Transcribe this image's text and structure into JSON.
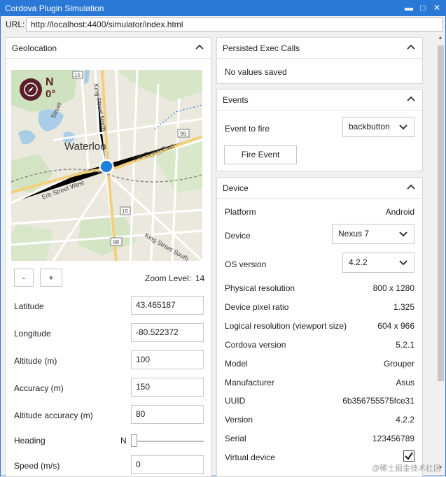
{
  "window": {
    "title": "Cordova Plugin Simulation"
  },
  "url_bar": {
    "label": "URL:",
    "value": "http://localhost:4400/simulator/index.html"
  },
  "geolocation": {
    "title": "Geolocation",
    "map": {
      "compass_heading": "N",
      "compass_degrees": "0°",
      "city_label": "Waterloo",
      "street_labels": [
        "Erb Street East",
        "Erb Street West",
        "King Street South",
        "King Street North",
        "Street"
      ],
      "route_numbers": [
        "98",
        "15",
        "98",
        "15"
      ]
    },
    "zoom_out_label": "-",
    "zoom_in_label": "+",
    "zoom_label": "Zoom Level:",
    "zoom_value": "14",
    "fields": [
      {
        "label": "Latitude",
        "value": "43.465187"
      },
      {
        "label": "Longitude",
        "value": "-80.522372"
      },
      {
        "label": "Altitude (m)",
        "value": "100"
      },
      {
        "label": "Accuracy (m)",
        "value": "150"
      },
      {
        "label": "Altitude accuracy (m)",
        "value": "80"
      }
    ],
    "heading_label": "Heading",
    "heading_value": "N",
    "heading_level": 0,
    "speed_label": "Speed (m/s)",
    "speed_value": "0"
  },
  "persisted": {
    "title": "Persisted Exec Calls",
    "empty_text": "No values saved"
  },
  "events": {
    "title": "Events",
    "event_label": "Event to fire",
    "event_selected": "backbutton",
    "fire_button": "Fire Event"
  },
  "device": {
    "title": "Device",
    "platform_label": "Platform",
    "platform_value": "Android",
    "device_label": "Device",
    "device_selected": "Nexus 7",
    "os_label": "OS version",
    "os_selected": "4.2.2",
    "rows": [
      {
        "label": "Physical resolution",
        "value": "800 x 1280"
      },
      {
        "label": "Device pixel ratio",
        "value": "1.325"
      },
      {
        "label": "Logical resolution (viewport size)",
        "value": "604 x 966"
      },
      {
        "label": "Cordova version",
        "value": "5.2.1"
      },
      {
        "label": "Model",
        "value": "Grouper"
      },
      {
        "label": "Manufacturer",
        "value": "Asus"
      },
      {
        "label": "UUID",
        "value": "6b356755575fce31"
      },
      {
        "label": "Version",
        "value": "4.2.2"
      },
      {
        "label": "Serial",
        "value": "123456789"
      }
    ],
    "virtual_label": "Virtual device",
    "virtual_checked": true
  },
  "watermark": "@稀土掘金技术社区",
  "colors": {
    "titlebar": "#2b79d7",
    "map_marker": "#1b7fdc",
    "compass_bg": "#5a1f2a"
  }
}
